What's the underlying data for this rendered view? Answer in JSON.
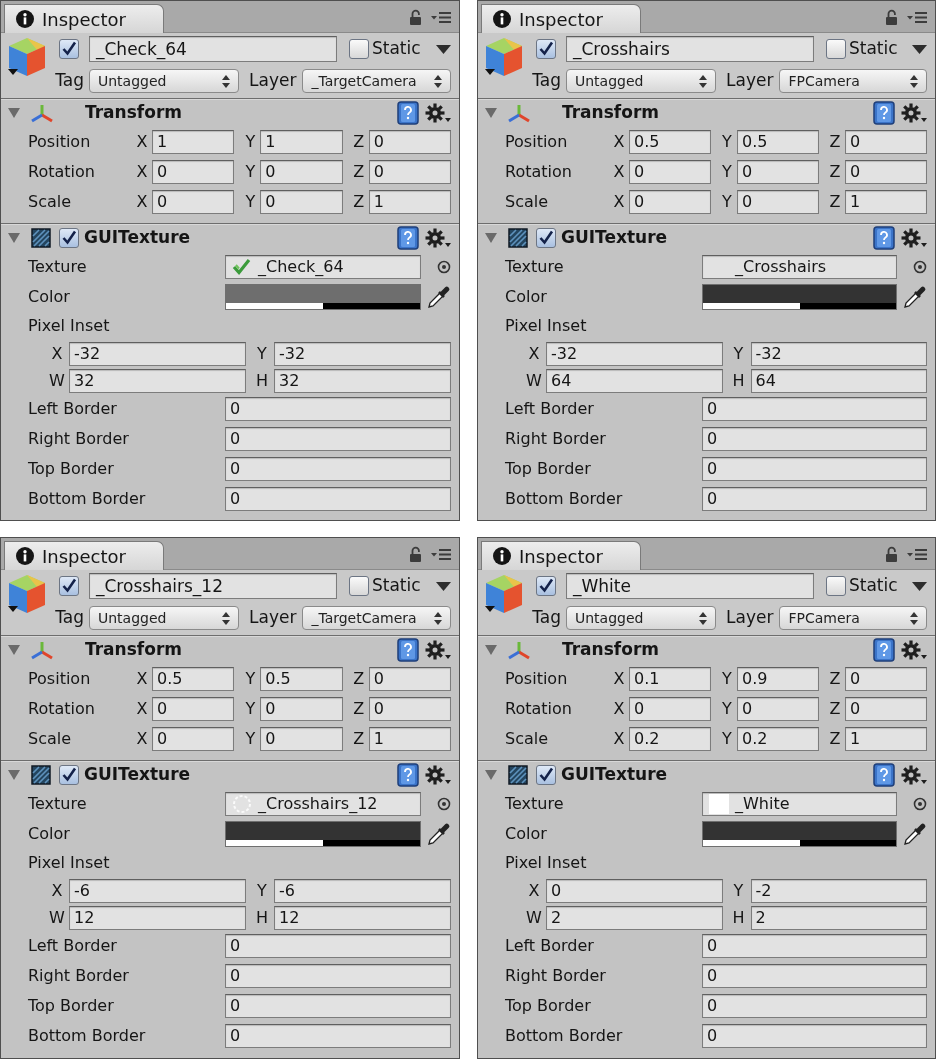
{
  "panels": [
    {
      "tab": {
        "label": "Inspector",
        "selected": true
      },
      "object": {
        "active": true,
        "name": "_Check_64",
        "static": false,
        "static_label": "Static",
        "tag_label": "Tag",
        "tag": "Untagged",
        "layer_label": "Layer",
        "layer": "_TargetCamera"
      },
      "transform": {
        "title": "Transform",
        "expanded": true,
        "rows": [
          {
            "label": "Position",
            "fields": [
              {
                "axis": "X",
                "value": "1"
              },
              {
                "axis": "Y",
                "value": "1"
              },
              {
                "axis": "Z",
                "value": "0"
              }
            ]
          },
          {
            "label": "Rotation",
            "fields": [
              {
                "axis": "X",
                "value": "0"
              },
              {
                "axis": "Y",
                "value": "0"
              },
              {
                "axis": "Z",
                "value": "0"
              }
            ]
          },
          {
            "label": "Scale",
            "fields": [
              {
                "axis": "X",
                "value": "0"
              },
              {
                "axis": "Y",
                "value": "0"
              },
              {
                "axis": "Z",
                "value": "1"
              }
            ]
          }
        ]
      },
      "gui_texture": {
        "title": "GUITexture",
        "expanded": true,
        "enabled": true,
        "texture": {
          "label": "Texture",
          "value": "_Check_64",
          "kind": "check"
        },
        "color": {
          "label": "Color",
          "color": "#6e6e6e",
          "level": 0.5
        },
        "pixel_inset": {
          "label": "Pixel Inset",
          "fields": [
            {
              "axis": "X",
              "value": "-32"
            },
            {
              "axis": "Y",
              "value": "-32"
            },
            {
              "axis": "W",
              "value": "32"
            },
            {
              "axis": "H",
              "value": "32"
            }
          ]
        },
        "borders": [
          {
            "label": "Left Border",
            "value": "0"
          },
          {
            "label": "Right Border",
            "value": "0"
          },
          {
            "label": "Top Border",
            "value": "0"
          },
          {
            "label": "Bottom Border",
            "value": "0"
          }
        ]
      }
    },
    {
      "tab": {
        "label": "Inspector",
        "selected": true
      },
      "object": {
        "active": true,
        "name": "_Crosshairs",
        "static": false,
        "static_label": "Static",
        "tag_label": "Tag",
        "tag": "Untagged",
        "layer_label": "Layer",
        "layer": "FPCamera"
      },
      "transform": {
        "title": "Transform",
        "expanded": true,
        "rows": [
          {
            "label": "Position",
            "fields": [
              {
                "axis": "X",
                "value": "0.5"
              },
              {
                "axis": "Y",
                "value": "0.5"
              },
              {
                "axis": "Z",
                "value": "0"
              }
            ]
          },
          {
            "label": "Rotation",
            "fields": [
              {
                "axis": "X",
                "value": "0"
              },
              {
                "axis": "Y",
                "value": "0"
              },
              {
                "axis": "Z",
                "value": "0"
              }
            ]
          },
          {
            "label": "Scale",
            "fields": [
              {
                "axis": "X",
                "value": "0"
              },
              {
                "axis": "Y",
                "value": "0"
              },
              {
                "axis": "Z",
                "value": "1"
              }
            ]
          }
        ]
      },
      "gui_texture": {
        "title": "GUITexture",
        "expanded": true,
        "enabled": true,
        "texture": {
          "label": "Texture",
          "value": "_Crosshairs",
          "kind": "blank"
        },
        "color": {
          "label": "Color",
          "color": "#333333",
          "level": 0.5
        },
        "pixel_inset": {
          "label": "Pixel Inset",
          "fields": [
            {
              "axis": "X",
              "value": "-32"
            },
            {
              "axis": "Y",
              "value": "-32"
            },
            {
              "axis": "W",
              "value": "64"
            },
            {
              "axis": "H",
              "value": "64"
            }
          ]
        },
        "borders": [
          {
            "label": "Left Border",
            "value": "0"
          },
          {
            "label": "Right Border",
            "value": "0"
          },
          {
            "label": "Top Border",
            "value": "0"
          },
          {
            "label": "Bottom Border",
            "value": "0"
          }
        ]
      }
    },
    {
      "tab": {
        "label": "Inspector",
        "selected": true
      },
      "object": {
        "active": true,
        "name": "_Crosshairs_12",
        "static": false,
        "static_label": "Static",
        "tag_label": "Tag",
        "tag": "Untagged",
        "layer_label": "Layer",
        "layer": "_TargetCamera"
      },
      "transform": {
        "title": "Transform",
        "expanded": true,
        "rows": [
          {
            "label": "Position",
            "fields": [
              {
                "axis": "X",
                "value": "0.5"
              },
              {
                "axis": "Y",
                "value": "0.5"
              },
              {
                "axis": "Z",
                "value": "0"
              }
            ]
          },
          {
            "label": "Rotation",
            "fields": [
              {
                "axis": "X",
                "value": "0"
              },
              {
                "axis": "Y",
                "value": "0"
              },
              {
                "axis": "Z",
                "value": "0"
              }
            ]
          },
          {
            "label": "Scale",
            "fields": [
              {
                "axis": "X",
                "value": "0"
              },
              {
                "axis": "Y",
                "value": "0"
              },
              {
                "axis": "Z",
                "value": "1"
              }
            ]
          }
        ]
      },
      "gui_texture": {
        "title": "GUITexture",
        "expanded": true,
        "enabled": true,
        "texture": {
          "label": "Texture",
          "value": "_Crosshairs_12",
          "kind": "ring"
        },
        "color": {
          "label": "Color",
          "color": "#333333",
          "level": 0.5
        },
        "pixel_inset": {
          "label": "Pixel Inset",
          "fields": [
            {
              "axis": "X",
              "value": "-6"
            },
            {
              "axis": "Y",
              "value": "-6"
            },
            {
              "axis": "W",
              "value": "12"
            },
            {
              "axis": "H",
              "value": "12"
            }
          ]
        },
        "borders": [
          {
            "label": "Left Border",
            "value": "0"
          },
          {
            "label": "Right Border",
            "value": "0"
          },
          {
            "label": "Top Border",
            "value": "0"
          },
          {
            "label": "Bottom Border",
            "value": "0"
          }
        ]
      }
    },
    {
      "tab": {
        "label": "Inspector",
        "selected": true
      },
      "object": {
        "active": true,
        "name": "_White",
        "static": false,
        "static_label": "Static",
        "tag_label": "Tag",
        "tag": "Untagged",
        "layer_label": "Layer",
        "layer": "FPCamera"
      },
      "transform": {
        "title": "Transform",
        "expanded": true,
        "rows": [
          {
            "label": "Position",
            "fields": [
              {
                "axis": "X",
                "value": "0.1"
              },
              {
                "axis": "Y",
                "value": "0.9"
              },
              {
                "axis": "Z",
                "value": "0"
              }
            ]
          },
          {
            "label": "Rotation",
            "fields": [
              {
                "axis": "X",
                "value": "0"
              },
              {
                "axis": "Y",
                "value": "0"
              },
              {
                "axis": "Z",
                "value": "0"
              }
            ]
          },
          {
            "label": "Scale",
            "fields": [
              {
                "axis": "X",
                "value": "0.2"
              },
              {
                "axis": "Y",
                "value": "0.2"
              },
              {
                "axis": "Z",
                "value": "1"
              }
            ]
          }
        ]
      },
      "gui_texture": {
        "title": "GUITexture",
        "expanded": true,
        "enabled": true,
        "texture": {
          "label": "Texture",
          "value": "_White",
          "kind": "white"
        },
        "color": {
          "label": "Color",
          "color": "#333333",
          "level": 0.5
        },
        "pixel_inset": {
          "label": "Pixel Inset",
          "fields": [
            {
              "axis": "X",
              "value": "0"
            },
            {
              "axis": "Y",
              "value": "-2"
            },
            {
              "axis": "W",
              "value": "2"
            },
            {
              "axis": "H",
              "value": "2"
            }
          ]
        },
        "borders": [
          {
            "label": "Left Border",
            "value": "0"
          },
          {
            "label": "Right Border",
            "value": "0"
          },
          {
            "label": "Top Border",
            "value": "0"
          },
          {
            "label": "Bottom Border",
            "value": "0"
          }
        ]
      }
    }
  ]
}
